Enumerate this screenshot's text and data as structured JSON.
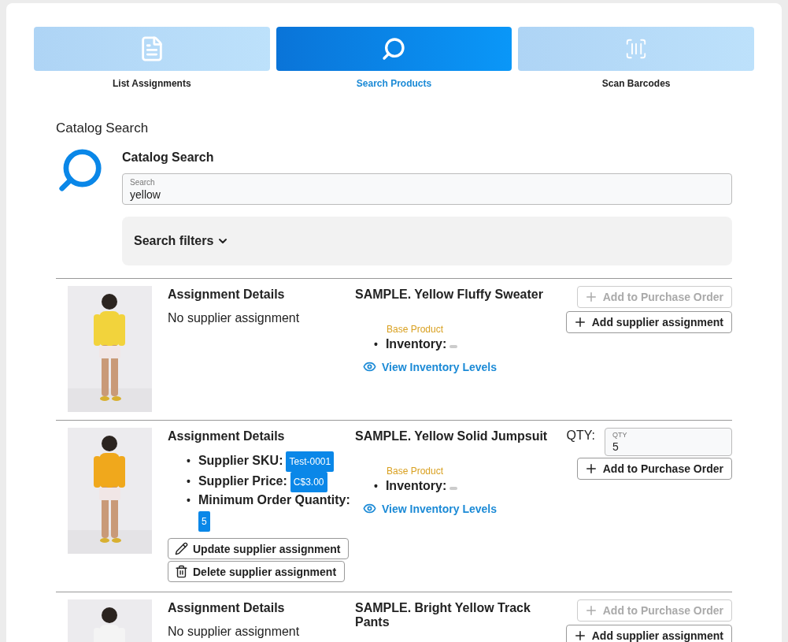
{
  "tabs": [
    {
      "label": "List Assignments",
      "selected": false
    },
    {
      "label": "Search Products",
      "selected": true
    },
    {
      "label": "Scan Barcodes",
      "selected": false
    }
  ],
  "section_title": "Catalog Search",
  "search": {
    "heading": "Catalog Search",
    "label": "Search",
    "value": "yellow"
  },
  "filters": {
    "label": "Search filters",
    "expanded": false
  },
  "products": [
    {
      "kind": "unassigned",
      "details_heading": "Assignment Details",
      "details_text": "No supplier assignment",
      "name": "SAMPLE. Yellow Fluffy Sweater",
      "base_label": "Base Product",
      "inventory": {
        "marker": "•",
        "label": "Inventory:"
      },
      "link": "View Inventory Levels",
      "actions": [
        {
          "label": "Add to Purchase Order",
          "disabled": true
        },
        {
          "label": "Add supplier assignment",
          "disabled": false
        }
      ]
    },
    {
      "kind": "assigned",
      "details_heading": "Assignment Details",
      "fields": [
        {
          "marker": "•",
          "label": "Supplier SKU:",
          "value": "Test-0001"
        },
        {
          "marker": "•",
          "label": "Supplier Price:",
          "value": "C$3.00"
        },
        {
          "marker": "•",
          "label": "Minimum Order Quantity:",
          "value": "5"
        }
      ],
      "buttons": [
        "Update supplier assignment",
        "Delete supplier assignment"
      ],
      "name": "SAMPLE. Yellow Solid Jumpsuit",
      "base_label": "Base Product",
      "inventory": {
        "marker": "•",
        "label": "Inventory:"
      },
      "link": "View Inventory Levels",
      "qty": {
        "label": "QTY:",
        "field_label": "QTY",
        "value": "5"
      },
      "actions": [
        {
          "label": "Add to Purchase Order",
          "disabled": false
        }
      ]
    },
    {
      "kind": "unassigned",
      "details_heading": "Assignment Details",
      "details_text": "No supplier assignment",
      "name": "SAMPLE. Bright Yellow Track Pants",
      "actions": [
        {
          "label": "Add to Purchase Order",
          "disabled": true
        },
        {
          "label": "Add supplier assignment",
          "disabled": false
        }
      ]
    }
  ]
}
